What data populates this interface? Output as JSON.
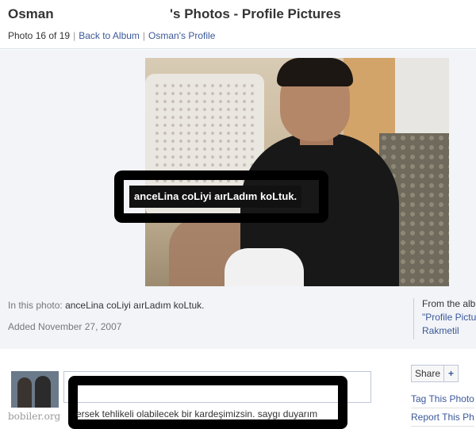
{
  "header": {
    "owner_name": "Osman",
    "title": "'s Photos - Profile Pictures"
  },
  "subnav": {
    "counter": "Photo 16 of 19",
    "back_to_album": "Back to Album",
    "owner_profile": "Osman's Profile"
  },
  "photo": {
    "tag_label": "anceLina coLiyi aırLadım koLtuk."
  },
  "info": {
    "in_photo_prefix": "In this photo:",
    "in_photo_name": "anceLina coLiyi aırLadım koLtuk.",
    "added": "Added November 27, 2007"
  },
  "from_album": {
    "title": "From the alb",
    "album_link": "\"Profile Pictu",
    "owner_link": "Rakmetil"
  },
  "comment": {
    "text": "ersek tehlikeli olabilecek bir kardeşimizsin. saygı duyarım",
    "watermark": "bobiler.org"
  },
  "share": {
    "label": "Share",
    "plus": "+"
  },
  "actions": {
    "tag": "Tag This Photo",
    "report": "Report This Ph"
  }
}
